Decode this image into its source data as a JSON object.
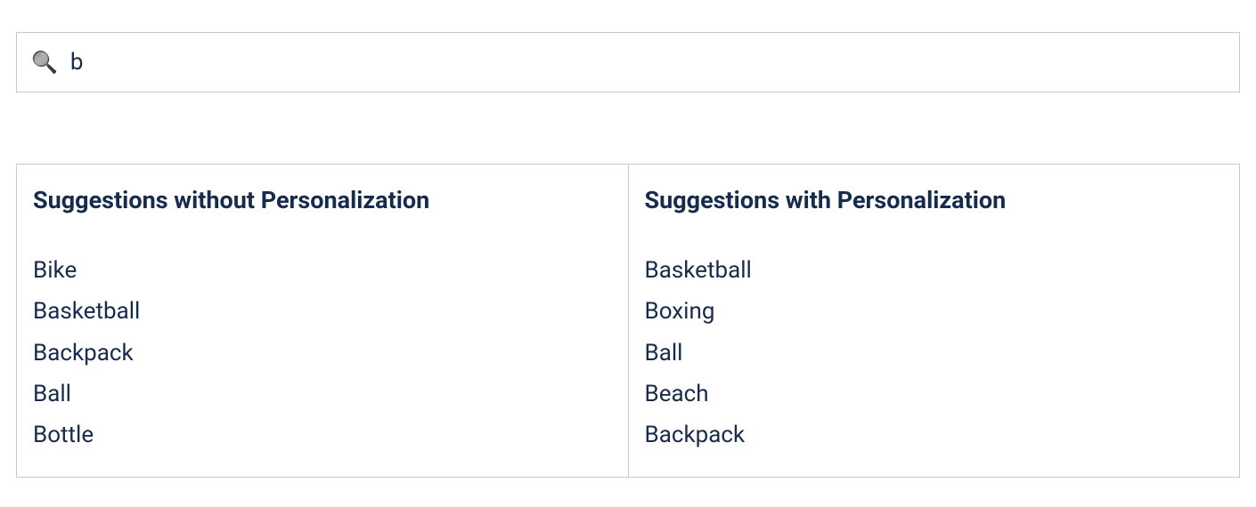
{
  "search": {
    "value": "b",
    "placeholder": ""
  },
  "columns": {
    "left": {
      "heading": "Suggestions without Personalization",
      "items": [
        "Bike",
        "Basketball",
        "Backpack",
        "Ball",
        "Bottle"
      ]
    },
    "right": {
      "heading": "Suggestions with Personalization",
      "items": [
        "Basketball",
        "Boxing",
        "Ball",
        "Beach",
        "Backpack"
      ]
    }
  },
  "icons": {
    "search": "🔍"
  }
}
